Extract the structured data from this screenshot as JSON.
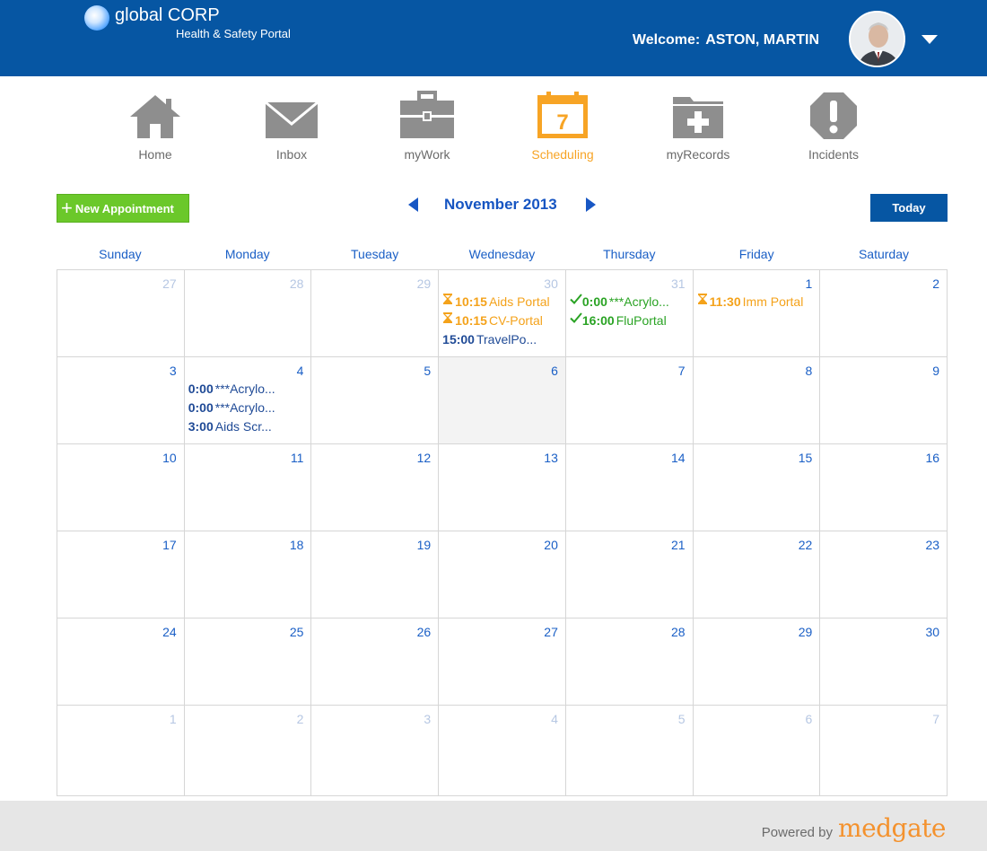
{
  "header": {
    "logo_text": "global CORP",
    "logo_sub": "Health & Safety Portal",
    "welcome_label": "Welcome:",
    "user_name": "ASTON, MARTIN",
    "colors": {
      "bar": "#0656a3"
    }
  },
  "nav": {
    "items": [
      {
        "label": "Home",
        "icon": "home-icon"
      },
      {
        "label": "Inbox",
        "icon": "inbox-icon"
      },
      {
        "label": "myWork",
        "icon": "briefcase-icon"
      },
      {
        "label": "Scheduling",
        "icon": "calendar-icon",
        "active": true,
        "calendar_number": "7"
      },
      {
        "label": "myRecords",
        "icon": "medical-folder-icon"
      },
      {
        "label": "Incidents",
        "icon": "alert-octagon-icon"
      }
    ],
    "active_color": "#f7a425"
  },
  "toolbar": {
    "new_appointment": "New Appointment",
    "month": "November 2013",
    "today": "Today"
  },
  "calendar": {
    "weekdays": [
      "Sunday",
      "Monday",
      "Tuesday",
      "Wednesday",
      "Thursday",
      "Friday",
      "Saturday"
    ],
    "weeks": [
      [
        {
          "day": "27",
          "other": true,
          "events": []
        },
        {
          "day": "28",
          "other": true,
          "events": []
        },
        {
          "day": "29",
          "other": true,
          "events": []
        },
        {
          "day": "30",
          "other": true,
          "events": [
            {
              "time": "10:15",
              "title": "Aids Portal",
              "status": "pending"
            },
            {
              "time": "10:15",
              "title": "CV-Portal",
              "status": "pending"
            },
            {
              "time": "15:00",
              "title": "TravelPo...",
              "status": "normal"
            }
          ]
        },
        {
          "day": "31",
          "other": true,
          "events": [
            {
              "time": "0:00",
              "title": "***Acrylo...",
              "status": "done"
            },
            {
              "time": "16:00",
              "title": "FluPortal",
              "status": "done"
            }
          ]
        },
        {
          "day": "1",
          "other": false,
          "events": [
            {
              "time": "11:30",
              "title": "Imm Portal",
              "status": "pending"
            }
          ]
        },
        {
          "day": "2",
          "other": false,
          "events": []
        }
      ],
      [
        {
          "day": "3",
          "other": false,
          "events": []
        },
        {
          "day": "4",
          "other": false,
          "events": [
            {
              "time": "0:00",
              "title": "***Acrylo...",
              "status": "normal"
            },
            {
              "time": "0:00",
              "title": "***Acrylo...",
              "status": "normal"
            },
            {
              "time": "3:00",
              "title": "Aids Scr...",
              "status": "normal"
            }
          ]
        },
        {
          "day": "5",
          "other": false,
          "events": []
        },
        {
          "day": "6",
          "other": false,
          "today": true,
          "events": []
        },
        {
          "day": "7",
          "other": false,
          "events": []
        },
        {
          "day": "8",
          "other": false,
          "events": []
        },
        {
          "day": "9",
          "other": false,
          "events": []
        }
      ],
      [
        {
          "day": "10",
          "other": false,
          "events": []
        },
        {
          "day": "11",
          "other": false,
          "events": []
        },
        {
          "day": "12",
          "other": false,
          "events": []
        },
        {
          "day": "13",
          "other": false,
          "events": []
        },
        {
          "day": "14",
          "other": false,
          "events": []
        },
        {
          "day": "15",
          "other": false,
          "events": []
        },
        {
          "day": "16",
          "other": false,
          "events": []
        }
      ],
      [
        {
          "day": "17",
          "other": false,
          "events": []
        },
        {
          "day": "18",
          "other": false,
          "events": []
        },
        {
          "day": "19",
          "other": false,
          "events": []
        },
        {
          "day": "20",
          "other": false,
          "events": []
        },
        {
          "day": "21",
          "other": false,
          "events": []
        },
        {
          "day": "22",
          "other": false,
          "events": []
        },
        {
          "day": "23",
          "other": false,
          "events": []
        }
      ],
      [
        {
          "day": "24",
          "other": false,
          "events": []
        },
        {
          "day": "25",
          "other": false,
          "events": []
        },
        {
          "day": "26",
          "other": false,
          "events": []
        },
        {
          "day": "27",
          "other": false,
          "events": []
        },
        {
          "day": "28",
          "other": false,
          "events": []
        },
        {
          "day": "29",
          "other": false,
          "events": []
        },
        {
          "day": "30",
          "other": false,
          "events": []
        }
      ],
      [
        {
          "day": "1",
          "other": true,
          "events": []
        },
        {
          "day": "2",
          "other": true,
          "events": []
        },
        {
          "day": "3",
          "other": true,
          "events": []
        },
        {
          "day": "4",
          "other": true,
          "events": []
        },
        {
          "day": "5",
          "other": true,
          "events": []
        },
        {
          "day": "6",
          "other": true,
          "events": []
        },
        {
          "day": "7",
          "other": true,
          "events": []
        }
      ]
    ]
  },
  "footer": {
    "powered_by": "Powered by",
    "brand": "medgate"
  }
}
